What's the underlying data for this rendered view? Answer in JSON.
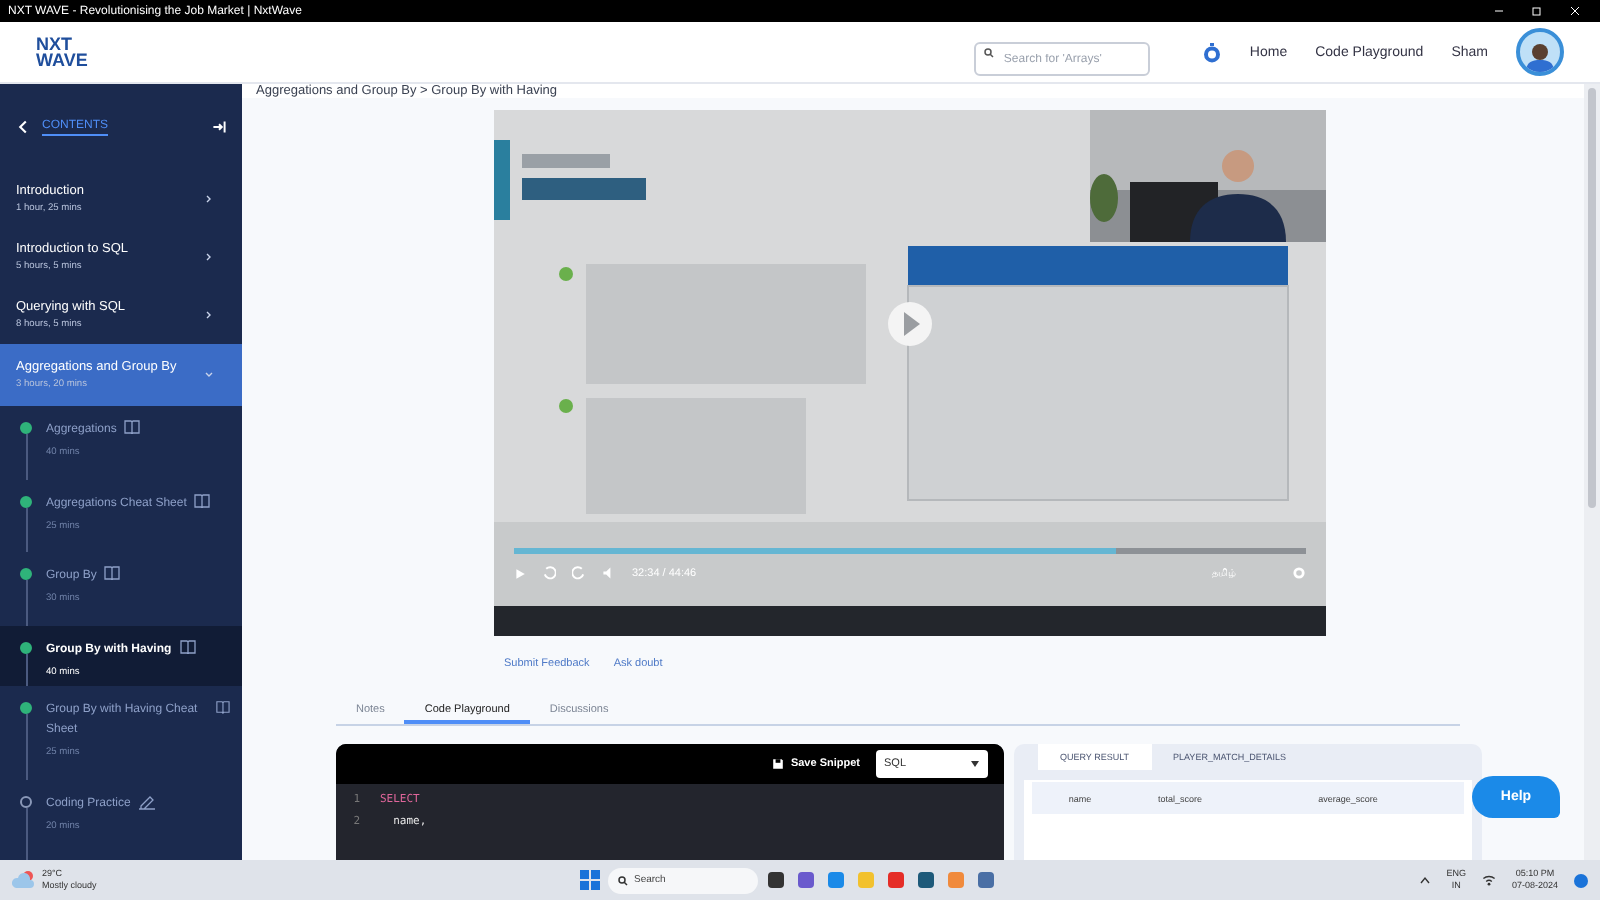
{
  "browser_title": "NXT WAVE - Revolutionising the Job Market | NxtWave",
  "header": {
    "logo": [
      "NXT",
      "WAVE"
    ],
    "search": {
      "placeholder": "Search for 'Arrays'"
    },
    "nav": [
      "Home",
      "Code Playground",
      "Sham"
    ]
  },
  "sidebar": {
    "title": "CONTENTS",
    "sections": [
      {
        "title": "Introduction",
        "duration": "1 hour, 25 mins",
        "expanded": false
      },
      {
        "title": "Introduction to SQL",
        "duration": "5 hours, 5 mins",
        "expanded": false
      },
      {
        "title": "Querying with SQL",
        "duration": "8 hours, 5 mins",
        "expanded": false
      },
      {
        "title": "Aggregations and Group By",
        "duration": "3 hours, 20 mins",
        "expanded": true,
        "children": [
          {
            "title": "Aggregations",
            "duration": "40 mins",
            "kind": "reading",
            "completed": true,
            "selected": false
          },
          {
            "title": "Aggregations Cheat Sheet",
            "duration": "25 mins",
            "kind": "reading",
            "completed": true,
            "selected": false
          },
          {
            "title": "Group By",
            "duration": "30 mins",
            "kind": "reading",
            "completed": true,
            "selected": false
          },
          {
            "title": "Group By with Having",
            "duration": "40 mins",
            "kind": "reading",
            "completed": true,
            "selected": true
          },
          {
            "title": "Group By with Having Cheat Sheet",
            "duration": "25 mins",
            "kind": "reading",
            "completed": true,
            "selected": false
          },
          {
            "title": "Coding Practice",
            "duration": "20 mins",
            "kind": "practice",
            "completed": false,
            "selected": false
          }
        ]
      }
    ]
  },
  "breadcrumb": "Aggregations and Group By > Group By with Having",
  "video": {
    "kind": "picture",
    "progress": {
      "level": 0.76
    },
    "time": "32:34 / 44:46",
    "language": "தமிழ்"
  },
  "actions": [
    "Submit Feedback",
    "Ask doubt"
  ],
  "tabs": [
    {
      "label": "Notes",
      "selected": false
    },
    {
      "label": "Code Playground",
      "selected": true
    },
    {
      "label": "Discussions",
      "selected": false
    }
  ],
  "editor": {
    "save_label": "Save Snippet",
    "language": "SQL",
    "lines": [
      {
        "number": "1",
        "code": "SELECT",
        "kind": "keyword"
      },
      {
        "number": "2",
        "code": "  name,",
        "kind": "plain"
      }
    ]
  },
  "result": {
    "tabs": [
      {
        "label": "QUERY RESULT",
        "selected": true
      },
      {
        "label": "PLAYER_MATCH_DETAILS",
        "selected": false
      }
    ],
    "columns": [
      "name",
      "total_score",
      "average_score"
    ]
  },
  "help": "Help",
  "taskbar": {
    "weather": {
      "temp": "29°C",
      "condition": "Mostly cloudy"
    },
    "search": "Search",
    "lang": [
      "ENG",
      "IN"
    ],
    "time": "05:10 PM",
    "date": "07-08-2024"
  }
}
